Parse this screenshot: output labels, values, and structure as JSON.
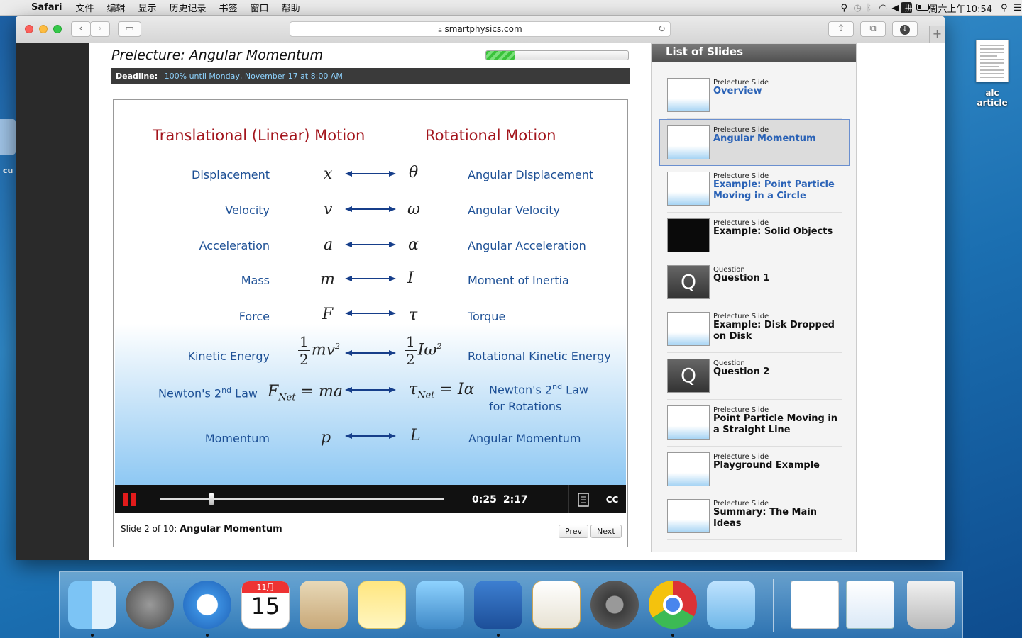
{
  "menubar": {
    "app_name": "Safari",
    "menus": [
      "文件",
      "编辑",
      "显示",
      "历史记录",
      "书签",
      "窗口",
      "帮助"
    ],
    "clock": "周六上午10:54"
  },
  "desktop": {
    "file_label": "alc article",
    "left_label": "cu"
  },
  "browser": {
    "url": "smartphysics.com"
  },
  "lecture": {
    "title": "Prelecture: Angular Momentum",
    "progress_fraction": 0.2,
    "deadline_label": "Deadline:",
    "deadline_value": "100% until Monday, November 17 at 8:00 AM"
  },
  "slide": {
    "left_heading": "Translational (Linear) Motion",
    "right_heading": "Rotational Motion",
    "rows": [
      {
        "linear": "Displacement",
        "rotational": "Angular Displacement"
      },
      {
        "linear": "Velocity",
        "rotational": "Angular Velocity"
      },
      {
        "linear": "Acceleration",
        "rotational": "Angular Acceleration"
      },
      {
        "linear": "Mass",
        "rotational": "Moment of Inertia"
      },
      {
        "linear": "Force",
        "rotational": "Torque"
      },
      {
        "linear": "Kinetic Energy",
        "rotational": "Rotational Kinetic Energy"
      },
      {
        "linear": "Newton's 2",
        "linear_sup": "nd",
        "linear_tail": " Law",
        "rotational": "Newton's 2",
        "rotational_sup": "nd",
        "rotational_tail": " Law",
        "rotational_line2": "for Rotations"
      },
      {
        "linear": "Momentum",
        "rotational": "Angular Momentum"
      }
    ],
    "symbols": {
      "x": "x",
      "theta": "θ",
      "v": "v",
      "omega": "ω",
      "a": "a",
      "alpha": "α",
      "m": "m",
      "I": "I",
      "F": "F",
      "tau": "τ",
      "half_n": "1",
      "half_d": "2",
      "mv2": "mv",
      "Iw2": "Iω",
      "sq": "2",
      "Fnet": "F",
      "Net": "Net",
      "eq_ma": " = ma",
      "taunet": "τ",
      "eq_ia": " = Iα",
      "p": "p",
      "L": "L"
    }
  },
  "player": {
    "current_time": "0:25",
    "total_time": "2:17",
    "playback_fraction": 0.18,
    "slide_position": "Slide 2 of 10:",
    "slide_name": "Angular Momentum",
    "prev_label": "Prev",
    "next_label": "Next",
    "cc_label": "CC"
  },
  "slides_list": {
    "heading": "List of Slides",
    "items": [
      {
        "type": "Prelecture Slide",
        "title": "Overview"
      },
      {
        "type": "Prelecture Slide",
        "title": "Angular Momentum"
      },
      {
        "type": "Prelecture Slide",
        "title": "Example: Point Particle Moving in a Circle"
      },
      {
        "type": "Prelecture Slide",
        "title": "Example: Solid Objects"
      },
      {
        "type": "Question",
        "title": "Question 1"
      },
      {
        "type": "Prelecture Slide",
        "title": "Example: Disk Dropped on Disk"
      },
      {
        "type": "Question",
        "title": "Question 2"
      },
      {
        "type": "Prelecture Slide",
        "title": "Point Particle Moving in a Straight Line"
      },
      {
        "type": "Prelecture Slide",
        "title": "Playground Example"
      },
      {
        "type": "Prelecture Slide",
        "title": "Summary: The Main Ideas"
      }
    ]
  },
  "dock": {
    "calendar_month": "11月",
    "calendar_day": "15",
    "apps": [
      "finder-icon",
      "launchpad-icon",
      "safari-icon",
      "calendar-icon",
      "mail-icon",
      "notes-icon",
      "iphoto-icon",
      "dictionary-icon",
      "pages-icon",
      "system-preferences-icon",
      "chrome-icon",
      "preview-icon",
      "document-icon",
      "screenshot-icon",
      "trash-icon"
    ]
  },
  "colors": {
    "heading_red": "#a3151c",
    "label_blue": "#1c4f95",
    "link_blue": "#2a62b6",
    "progress_green": "#3ac23a",
    "pause_red": "#e21b1b"
  }
}
